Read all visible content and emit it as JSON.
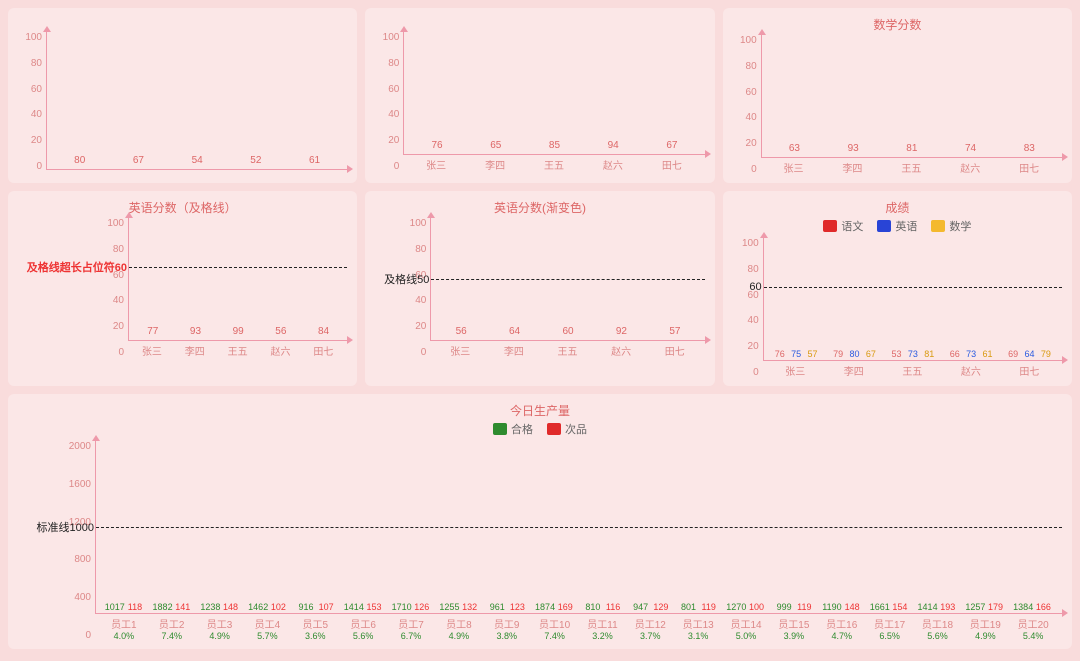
{
  "chart_data": [
    {
      "id": "c1",
      "type": "bar",
      "title": "",
      "categories": [
        "",
        "",
        "",
        "",
        ""
      ],
      "values": [
        80,
        67,
        54,
        52,
        61
      ],
      "ylim": [
        0,
        100
      ],
      "yticks": [
        0,
        20,
        40,
        60,
        80,
        100
      ],
      "color": "solid-red"
    },
    {
      "id": "c2",
      "type": "bar",
      "title": "",
      "categories": [
        "张三",
        "李四",
        "王五",
        "赵六",
        "田七"
      ],
      "values": [
        76,
        65,
        85,
        94,
        67
      ],
      "ylim": [
        0,
        100
      ],
      "yticks": [
        0,
        20,
        40,
        60,
        80,
        100
      ],
      "color": "solid-red"
    },
    {
      "id": "c3",
      "type": "bar",
      "title": "数学分数",
      "categories": [
        "张三",
        "李四",
        "王五",
        "赵六",
        "田七"
      ],
      "values": [
        63,
        93,
        81,
        74,
        83
      ],
      "ylim": [
        0,
        100
      ],
      "yticks": [
        0,
        20,
        40,
        60,
        80,
        100
      ],
      "color": "solid-red"
    },
    {
      "id": "c4",
      "type": "bar",
      "title": "英语分数（及格线）",
      "categories": [
        "张三",
        "李四",
        "王五",
        "赵六",
        "田七"
      ],
      "values": [
        77,
        93,
        99,
        56,
        84
      ],
      "ylim": [
        0,
        100
      ],
      "yticks": [
        0,
        20,
        40,
        60,
        80,
        100
      ],
      "threshold": {
        "label": "及格线超长占位符60",
        "value": 60,
        "label_color": "red"
      },
      "color": "solid-red"
    },
    {
      "id": "c5",
      "type": "bar",
      "title": "英语分数(渐变色)",
      "categories": [
        "张三",
        "李四",
        "王五",
        "赵六",
        "田七"
      ],
      "values": [
        56,
        64,
        60,
        92,
        57
      ],
      "ylim": [
        0,
        100
      ],
      "yticks": [
        0,
        20,
        40,
        60,
        80,
        100
      ],
      "threshold": {
        "label": "及格线50",
        "value": 50,
        "label_color": "black"
      },
      "color": "grad-red"
    },
    {
      "id": "c6",
      "type": "bar",
      "title": "成绩",
      "categories": [
        "张三",
        "李四",
        "王五",
        "赵六",
        "田七"
      ],
      "series": [
        {
          "name": "语文",
          "color": "red",
          "values": [
            76,
            79,
            53,
            66,
            69
          ]
        },
        {
          "name": "英语",
          "color": "blue",
          "values": [
            75,
            80,
            73,
            73,
            64
          ]
        },
        {
          "name": "数学",
          "color": "orange",
          "values": [
            57,
            67,
            81,
            61,
            79
          ]
        }
      ],
      "ylim": [
        0,
        100
      ],
      "yticks": [
        0,
        20,
        40,
        60,
        80,
        100
      ],
      "threshold": {
        "label": "60",
        "value": 60,
        "label_color": "black"
      },
      "legend": true
    },
    {
      "id": "c7",
      "type": "bar",
      "title": "今日生产量",
      "categories": [
        "员工1",
        "员工2",
        "员工3",
        "员工4",
        "员工5",
        "员工6",
        "员工7",
        "员工8",
        "员工9",
        "员工10",
        "员工11",
        "员工12",
        "员工13",
        "员工14",
        "员工15",
        "员工16",
        "员工17",
        "员工18",
        "员工19",
        "员工20"
      ],
      "sub_categories": [
        "4.0%",
        "7.4%",
        "4.9%",
        "5.7%",
        "3.6%",
        "5.6%",
        "6.7%",
        "4.9%",
        "3.8%",
        "7.4%",
        "3.2%",
        "3.7%",
        "3.1%",
        "5.0%",
        "3.9%",
        "4.7%",
        "6.5%",
        "5.6%",
        "4.9%",
        "5.4%"
      ],
      "series": [
        {
          "name": "合格",
          "color": "green",
          "values": [
            1017,
            1882,
            1238,
            1462,
            916,
            1414,
            1710,
            1255,
            961,
            1874,
            810,
            947,
            801,
            1270,
            999,
            1190,
            1661,
            1414,
            1257,
            1384
          ]
        },
        {
          "name": "次品",
          "color": "red",
          "values": [
            118,
            141,
            148,
            102,
            107,
            153,
            126,
            132,
            123,
            169,
            116,
            129,
            119,
            100,
            119,
            148,
            154,
            193,
            179,
            166
          ]
        }
      ],
      "ylim": [
        0,
        2000
      ],
      "yticks": [
        0,
        400,
        800,
        1200,
        1600,
        2000
      ],
      "threshold": {
        "label": "标准线1000",
        "value": 1000,
        "label_color": "black"
      },
      "legend": true,
      "wide": true
    }
  ]
}
